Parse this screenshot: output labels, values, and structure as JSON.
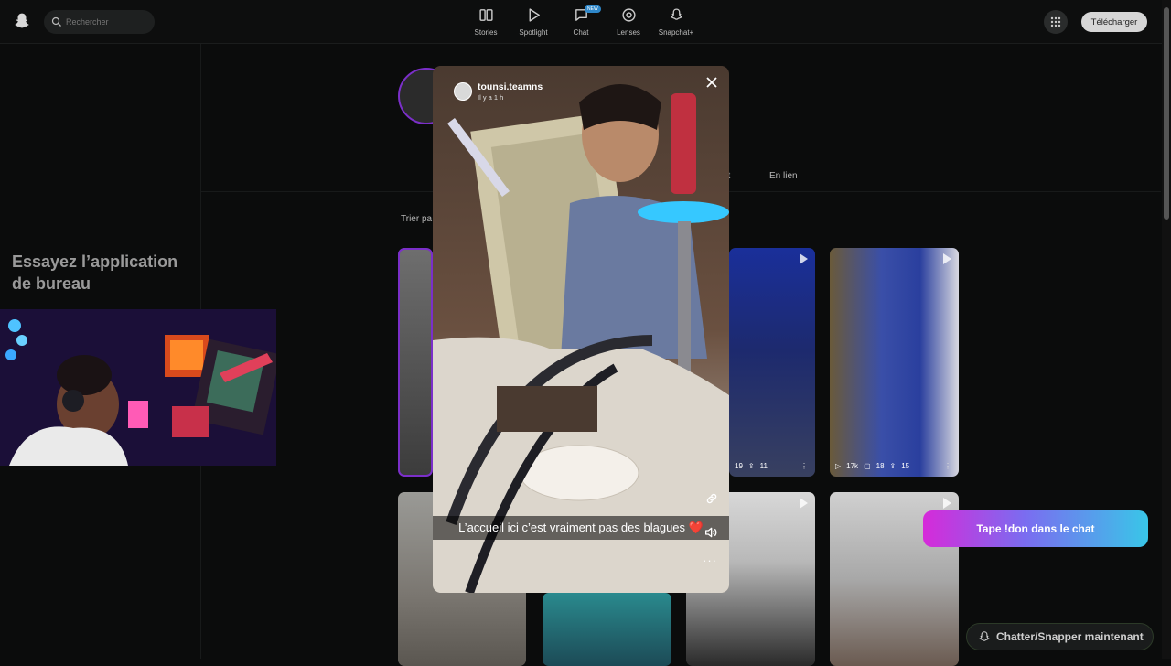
{
  "search": {
    "placeholder": "Rechercher"
  },
  "nav": [
    {
      "label": "Stories",
      "icon": "stories-icon"
    },
    {
      "label": "Spotlight",
      "icon": "play-icon"
    },
    {
      "label": "Chat",
      "icon": "chat-icon",
      "badge": "NEW"
    },
    {
      "label": "Lenses",
      "icon": "lenses-icon"
    },
    {
      "label": "Snapchat+",
      "icon": "snapchat-plus-icon"
    }
  ],
  "header": {
    "download_label": "Télécharger"
  },
  "promo": {
    "title": "Essayez l’application de bureau"
  },
  "profile": {
    "tabs": {
      "partial": "nt",
      "linked": "En lien"
    },
    "sort_label": "Trier pa"
  },
  "tiles": {
    "tile_b": {
      "views": "19",
      "shares": "11"
    },
    "tile_c": {
      "views": "17k",
      "comments": "18",
      "shares": "15"
    }
  },
  "story": {
    "username": "tounsi.teamns",
    "time": "Il y a 1 h",
    "caption": "L’accueil ici c’est vraiment pas des blagues ❤️"
  },
  "overlays": {
    "donation_cta": "Tape !don dans le chat",
    "chat_now": "Chatter/Snapper maintenant"
  },
  "colors": {
    "accent_purple": "#7b2fc9",
    "badge_blue": "#2e87c9",
    "cta_gradient": [
      "#d62ad9",
      "#7b6cf0",
      "#39c6e8"
    ]
  }
}
